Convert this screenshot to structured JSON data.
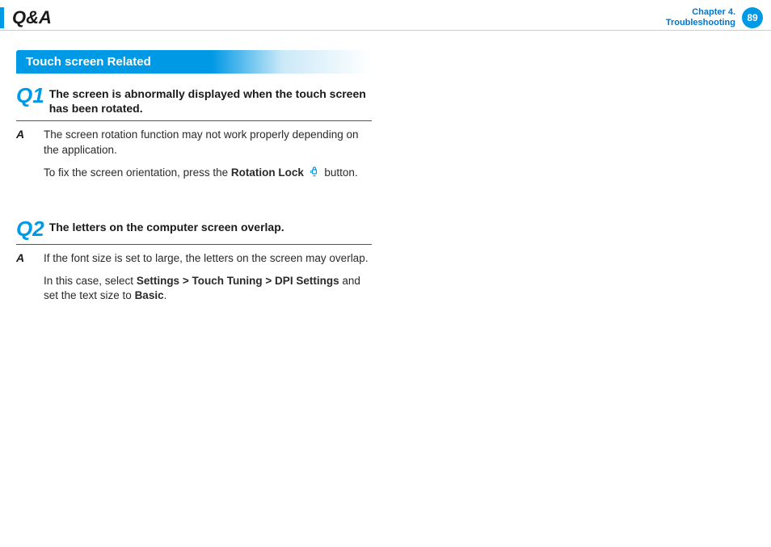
{
  "header": {
    "title": "Q&A",
    "chapter_line1": "Chapter 4.",
    "chapter_line2": "Troubleshooting",
    "page_number": "89"
  },
  "section": {
    "heading": "Touch screen Related"
  },
  "qa": [
    {
      "q_label": "Q1",
      "question": "The screen is abnormally displayed when the touch screen has been rotated.",
      "a_label": "A",
      "answer_p1": "The screen rotation function may not work properly depending on the application.",
      "answer_p2_pre": "To fix the screen orientation, press the ",
      "answer_p2_bold": "Rotation Lock",
      "answer_p2_post": " button."
    },
    {
      "q_label": "Q2",
      "question": "The letters on the computer screen overlap.",
      "a_label": "A",
      "answer_p1": "If the font size is set to large, the letters on the screen may overlap.",
      "answer_p2_pre": "In this case, select ",
      "answer_p2_bold": "Settings > Touch Tuning > DPI Settings",
      "answer_p2_mid": " and set the text size to ",
      "answer_p2_bold2": "Basic",
      "answer_p2_post": "."
    }
  ]
}
